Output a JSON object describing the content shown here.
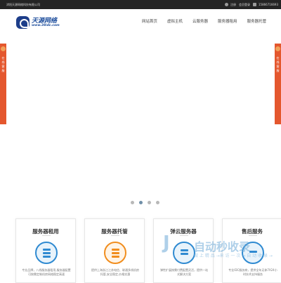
{
  "topbar": {
    "company": "沭阳天源网络科技有限公司",
    "register": "注册",
    "login": "会员登录",
    "phone": "15866716693"
  },
  "header": {
    "logo_name": "天源网络",
    "logo_url": "www.38idc.com"
  },
  "nav": {
    "items": [
      "网站首页",
      "虚拟主机",
      "云服务器",
      "服务器租用",
      "服务器托管"
    ]
  },
  "sidebar": {
    "left_text": "在线客服",
    "right_text": "在线客服"
  },
  "slider": {
    "dot_count": 4,
    "active_index": 1
  },
  "cards": [
    {
      "title": "服务器租用",
      "icon": "server-icon",
      "color": "#2f8ad1",
      "desc": "专业品牌，八线服务器租用,服务器配置可按需定制机房网络稳定高速"
    },
    {
      "title": "服务器托管",
      "icon": "server-icon",
      "color": "#f18d1d",
      "desc": "提供上海浙江江苏电信、联通多线机房托管,安全稳定,价格实惠"
    },
    {
      "title": "弹云服务器",
      "icon": "cloud-icon",
      "color": "#2f8ad1",
      "desc": "弹性扩展按需付费配置灵活，提供一站式解决方案"
    },
    {
      "title": "售后服务",
      "icon": "support-icon",
      "color": "#2f8ad1",
      "desc": "专业IDC服务商，提供全年无休7X24小时技术支持服务"
    }
  ],
  "watermark": {
    "mark": "J",
    "title": "自动秒收录",
    "subtitle": "做 上 精 品 →来 访 一 次 → 自 动 收 录 →"
  }
}
